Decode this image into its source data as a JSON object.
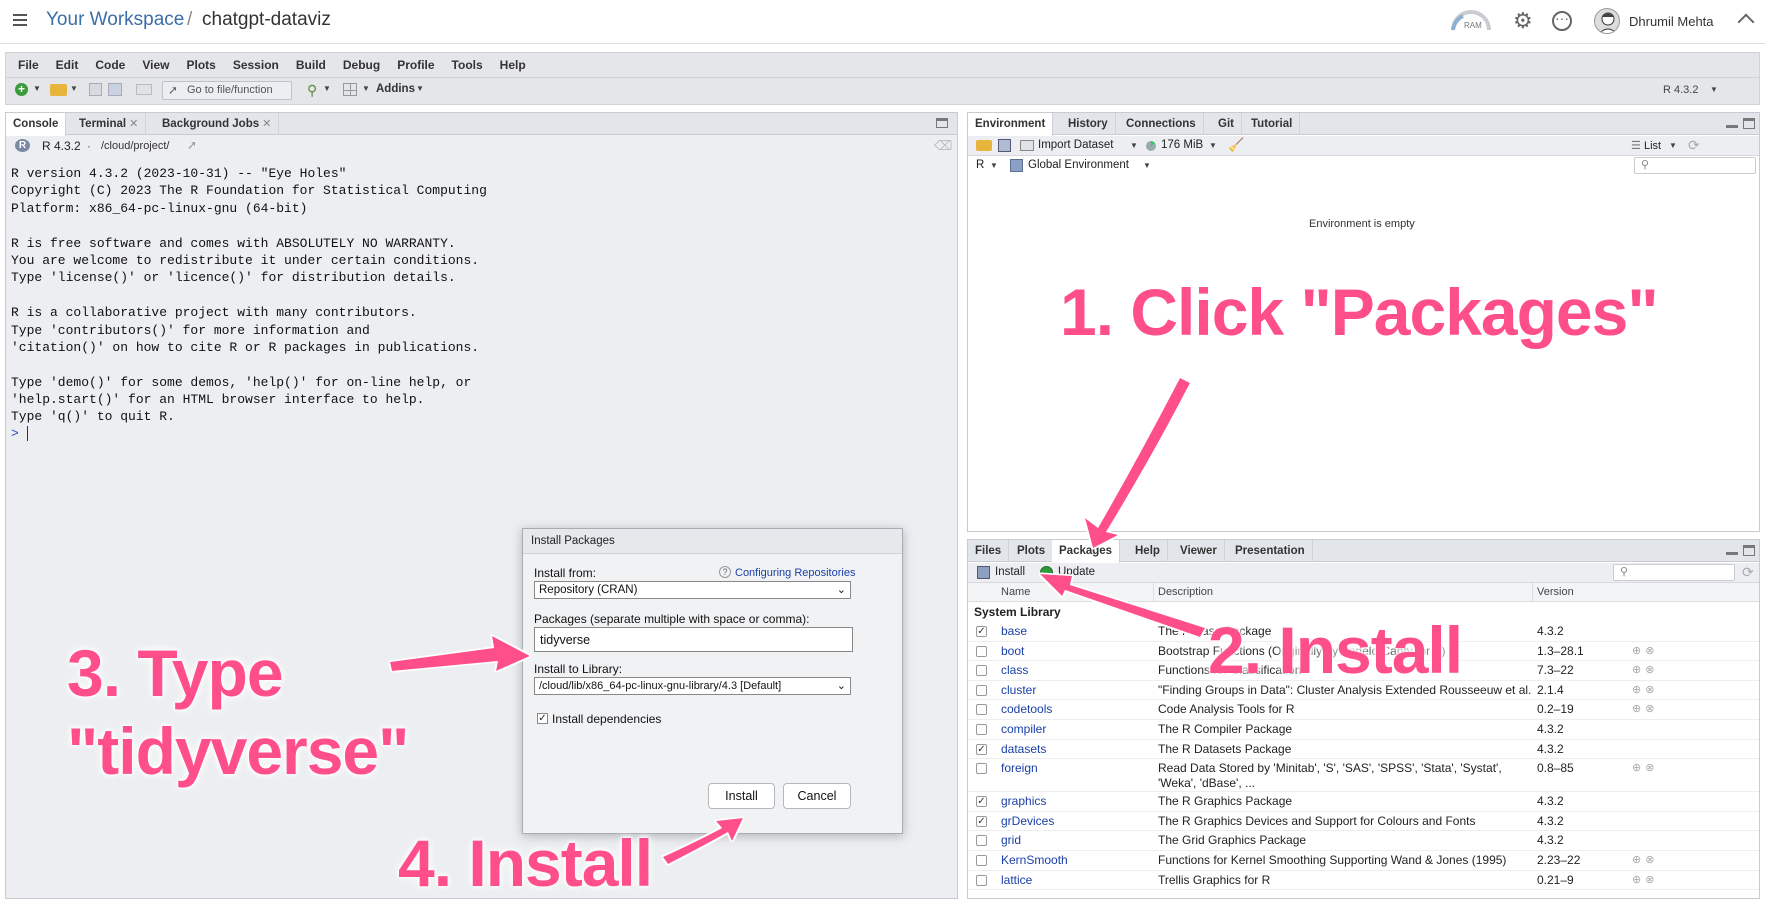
{
  "topbar": {
    "workspace": "Your Workspace",
    "separator": "/",
    "project": "chatgpt-dataviz",
    "ram_label": "RAM",
    "user_name": "Dhrumil Mehta"
  },
  "menu": [
    "File",
    "Edit",
    "Code",
    "View",
    "Plots",
    "Session",
    "Build",
    "Debug",
    "Profile",
    "Tools",
    "Help"
  ],
  "toolbar": {
    "goto_placeholder": "Go to file/function",
    "addins": "Addins",
    "r_version": "R 4.3.2"
  },
  "left_pane": {
    "tabs": [
      "Console",
      "Terminal",
      "Background Jobs"
    ],
    "r_version": "R 4.3.2",
    "dot": "·",
    "path": "/cloud/project/",
    "console_lines": [
      "R version 4.3.2 (2023-10-31) -- \"Eye Holes\"",
      "Copyright (C) 2023 The R Foundation for Statistical Computing",
      "Platform: x86_64-pc-linux-gnu (64-bit)",
      "",
      "R is free software and comes with ABSOLUTELY NO WARRANTY.",
      "You are welcome to redistribute it under certain conditions.",
      "Type 'license()' or 'licence()' for distribution details.",
      "",
      "R is a collaborative project with many contributors.",
      "Type 'contributors()' for more information and",
      "'citation()' on how to cite R or R packages in publications.",
      "",
      "Type 'demo()' for some demos, 'help()' for on-line help, or",
      "'help.start()' for an HTML browser interface to help.",
      "Type 'q()' to quit R."
    ],
    "prompt": ">"
  },
  "env_pane": {
    "tabs": [
      "Environment",
      "History",
      "Connections",
      "Git",
      "Tutorial"
    ],
    "import_dataset": "Import Dataset",
    "memory": "176 MiB",
    "view_mode": "List",
    "lang": "R",
    "scope": "Global Environment",
    "empty_msg": "Environment is empty"
  },
  "files_pane": {
    "tabs": [
      "Files",
      "Plots",
      "Packages",
      "Help",
      "Viewer",
      "Presentation"
    ],
    "install_label": "Install",
    "update_label": "Update",
    "col_name": "Name",
    "col_desc": "Description",
    "col_version": "Version",
    "section": "System Library",
    "packages": [
      {
        "checked": true,
        "name": "base",
        "desc": "The R Base Package",
        "version": "4.3.2"
      },
      {
        "checked": false,
        "name": "boot",
        "desc": "Bootstrap Functions (Originally by Angelo Canty for S)",
        "version": "1.3–28.1"
      },
      {
        "checked": false,
        "name": "class",
        "desc": "Functions for Classification",
        "version": "7.3–22"
      },
      {
        "checked": false,
        "name": "cluster",
        "desc": "\"Finding Groups in Data\": Cluster Analysis Extended Rousseeuw et al.",
        "version": "2.1.4"
      },
      {
        "checked": false,
        "name": "codetools",
        "desc": "Code Analysis Tools for R",
        "version": "0.2–19"
      },
      {
        "checked": false,
        "name": "compiler",
        "desc": "The R Compiler Package",
        "version": "4.3.2"
      },
      {
        "checked": true,
        "name": "datasets",
        "desc": "The R Datasets Package",
        "version": "4.3.2"
      },
      {
        "checked": false,
        "name": "foreign",
        "desc": "Read Data Stored by 'Minitab', 'S', 'SAS', 'SPSS', 'Stata', 'Systat', 'Weka', 'dBase', ...",
        "version": "0.8–85"
      },
      {
        "checked": true,
        "name": "graphics",
        "desc": "The R Graphics Package",
        "version": "4.3.2"
      },
      {
        "checked": true,
        "name": "grDevices",
        "desc": "The R Graphics Devices and Support for Colours and Fonts",
        "version": "4.3.2"
      },
      {
        "checked": false,
        "name": "grid",
        "desc": "The Grid Graphics Package",
        "version": "4.3.2"
      },
      {
        "checked": false,
        "name": "KernSmooth",
        "desc": "Functions for Kernel Smoothing Supporting Wand & Jones (1995)",
        "version": "2.23–22"
      },
      {
        "checked": false,
        "name": "lattice",
        "desc": "Trellis Graphics for R",
        "version": "0.21–9"
      }
    ]
  },
  "dialog": {
    "title": "Install Packages",
    "install_from_label": "Install from:",
    "help_link": "Configuring Repositories",
    "install_from_value": "Repository (CRAN)",
    "packages_label": "Packages (separate multiple with space or comma):",
    "packages_value": "tidyverse",
    "library_label": "Install to Library:",
    "library_value": "/cloud/lib/x86_64-pc-linux-gnu-library/4.3 [Default]",
    "deps_label": "Install dependencies",
    "install_button": "Install",
    "cancel_button": "Cancel"
  },
  "annotations": {
    "step1": "1. Click \"Packages\"",
    "step2": "2. Install",
    "step3_line1": "3. Type",
    "step3_line2": "\"tidyverse\"",
    "step4": "4. Install"
  },
  "colors": {
    "annotation": "#ff4f8b",
    "link": "#1a40a8",
    "accent": "#2c6fad"
  }
}
